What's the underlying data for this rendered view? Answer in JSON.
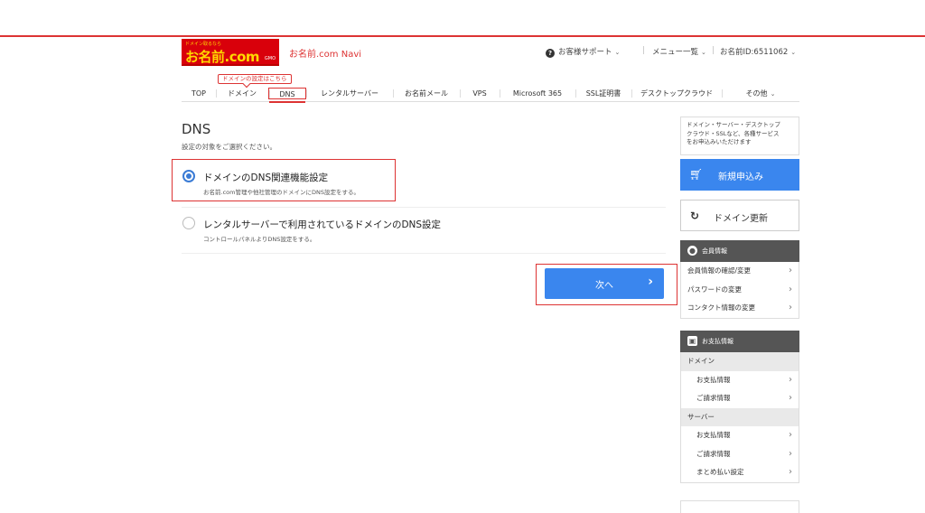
{
  "header": {
    "logo_tagline": "ドメイン取るなら",
    "logo_text": "お名前.com",
    "logo_sub": "GMO",
    "navi_title": "お名前.com Navi",
    "support_label": "お客様サポート",
    "menu_label": "メニュー一覧",
    "account_label": "お名前ID:6511062"
  },
  "tooltip": "ドメインの設定はこちら",
  "gnav": [
    "TOP",
    "ドメイン",
    "DNS",
    "レンタルサーバー",
    "お名前メール",
    "VPS",
    "Microsoft 365",
    "SSL証明書",
    "デスクトップクラウド",
    "その他"
  ],
  "main": {
    "title": "DNS",
    "description": "設定の対象をご選択ください。",
    "options": [
      {
        "label": "ドメインのDNS関連機能設定",
        "sub": "お名前.com管理や他社管理のドメインにDNS設定をする。",
        "checked": true
      },
      {
        "label": "レンタルサーバーで利用されているドメインのDNS設定",
        "sub": "コントロールパネルよりDNS設定をする。",
        "checked": false
      }
    ],
    "next_label": "次へ"
  },
  "sidebar": {
    "promo_lines": [
      "ドメイン・サーバー・デスクトップ",
      "クラウド・SSLなど、各種サービス",
      "をお申込みいただけます"
    ],
    "new_label": "新規申込み",
    "renew_label": "ドメイン更新",
    "member": {
      "title": "会員情報",
      "items": [
        "会員情報の確認/変更",
        "パスワードの変更",
        "コンタクト情報の変更"
      ]
    },
    "payment": {
      "title": "お支払情報",
      "groups": [
        {
          "name": "ドメイン",
          "items": [
            "お支払情報",
            "ご請求情報"
          ]
        },
        {
          "name": "サーバー",
          "items": [
            "お支払情報",
            "ご請求情報",
            "まとめ払い設定"
          ]
        }
      ]
    }
  }
}
